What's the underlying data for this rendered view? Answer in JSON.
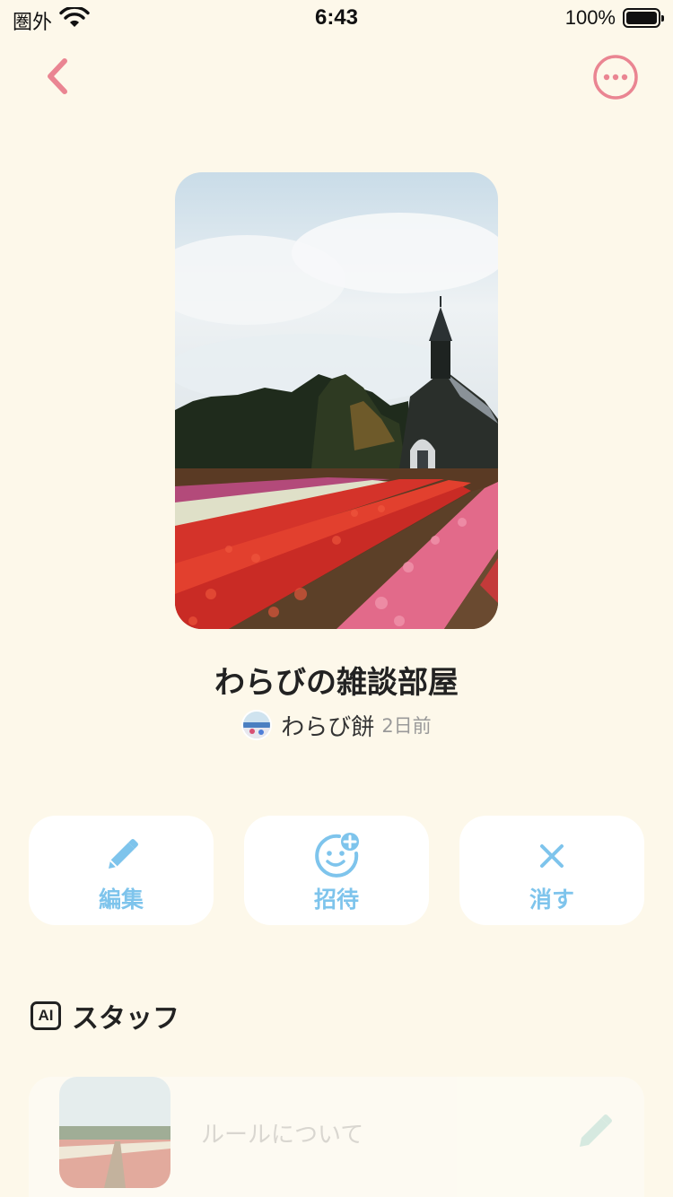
{
  "status_bar": {
    "carrier": "圏外",
    "time": "6:43",
    "battery": "100%"
  },
  "nav": {
    "back_icon": "chevron-left-icon",
    "more_icon": "more-horizontal-circle-icon",
    "accent_color": "#ea8592"
  },
  "room": {
    "title": "わらびの雑談部屋",
    "owner_name": "わらび餅",
    "posted_time": "2日前"
  },
  "actions": [
    {
      "label": "編集",
      "icon": "pencil-icon"
    },
    {
      "label": "招待",
      "icon": "add-face-icon"
    },
    {
      "label": "消す",
      "icon": "close-icon"
    }
  ],
  "action_color": "#7ec4ec",
  "section": {
    "badge": "AI",
    "title": "スタッフ"
  },
  "staff": [
    {
      "name": "ルールについて",
      "icon": "pencil-icon"
    }
  ]
}
